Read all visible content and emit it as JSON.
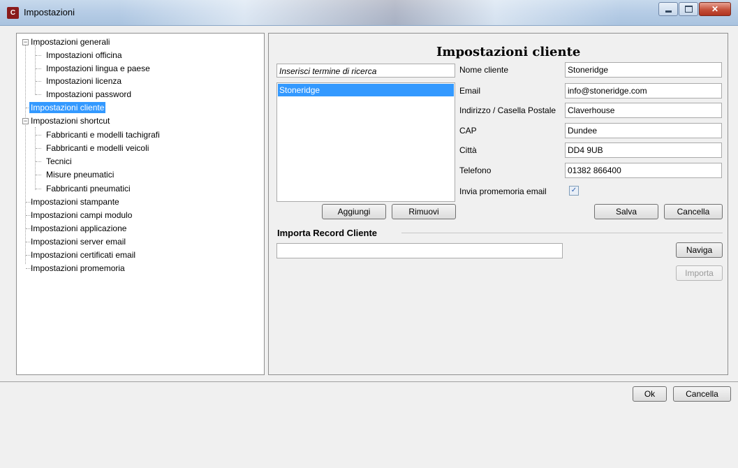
{
  "window": {
    "title": "Impostazioni",
    "icon_text": "C"
  },
  "tree": {
    "items": [
      {
        "label": "Impostazioni generali"
      },
      {
        "label": "Impostazioni officina"
      },
      {
        "label": "Impostazioni lingua e paese"
      },
      {
        "label": "Impostazioni licenza"
      },
      {
        "label": "Impostazioni password"
      },
      {
        "label": "Impostazioni cliente"
      },
      {
        "label": "Impostazioni shortcut"
      },
      {
        "label": "Fabbricanti e modelli tachigrafi"
      },
      {
        "label": "Fabbricanti e modelli veicoli"
      },
      {
        "label": "Tecnici"
      },
      {
        "label": "Misure pneumatici"
      },
      {
        "label": "Fabbricanti pneumatici"
      },
      {
        "label": "Impostazioni stampante"
      },
      {
        "label": "Impostazioni campi modulo"
      },
      {
        "label": "Impostazioni applicazione"
      },
      {
        "label": "Impostazioni server email"
      },
      {
        "label": "Impostazioni certificati email"
      },
      {
        "label": "Impostazioni promemoria"
      }
    ],
    "selected": "Impostazioni cliente"
  },
  "customer": {
    "heading": "Impostazioni cliente",
    "search_placeholder": "Inserisci termine di ricerca",
    "list": [
      "Stoneridge"
    ],
    "fields": [
      {
        "label": "Nome cliente",
        "value": "Stoneridge"
      },
      {
        "label": "Email",
        "value": "info@stoneridge.com"
      },
      {
        "label": "Indirizzo / Casella Postale",
        "value": "Claverhouse"
      },
      {
        "label": "CAP",
        "value": "Dundee"
      },
      {
        "label": "Città",
        "value": "DD4 9UB"
      },
      {
        "label": "Telefono",
        "value": "01382 866400"
      }
    ],
    "reminder_label": "Invia promemoria email",
    "reminder_checked": true,
    "add_label": "Aggiungi",
    "remove_label": "Rimuovi",
    "save_label": "Salva",
    "cancel_label": "Cancella"
  },
  "import": {
    "heading": "Importa Record Cliente",
    "path_value": "",
    "browse_label": "Naviga",
    "import_label": "Importa"
  },
  "footer": {
    "ok_label": "Ok",
    "cancel_label": "Cancella"
  }
}
